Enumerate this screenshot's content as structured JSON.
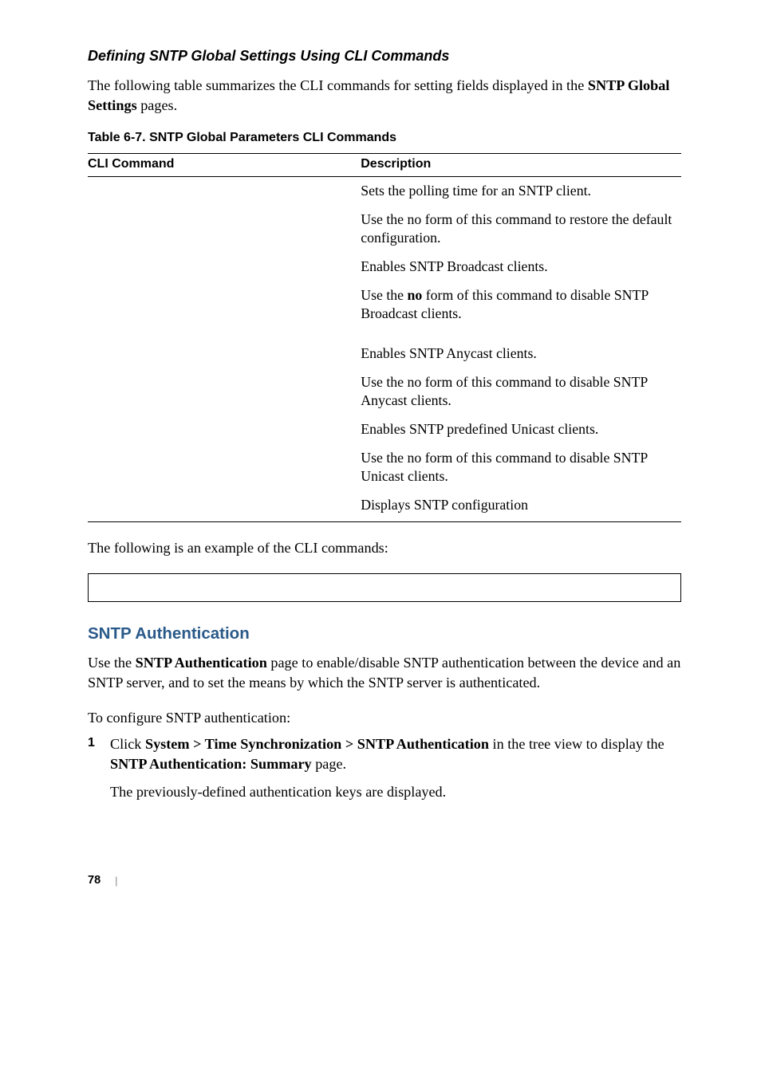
{
  "section1": {
    "heading": "Defining SNTP Global Settings Using CLI Commands",
    "intro_part1": "The following table summarizes the CLI commands for setting fields displayed in the ",
    "intro_bold": "SNTP Global Settings",
    "intro_part2": " pages."
  },
  "table": {
    "caption": "Table 6-7.    SNTP Global Parameters CLI Commands",
    "header_cmd": "CLI Command",
    "header_desc": "Description",
    "rows": [
      {
        "desc": "Sets the polling time for an SNTP client."
      },
      {
        "desc": "Use the no form of this command to restore the default configuration."
      },
      {
        "desc": "Enables SNTP Broadcast clients."
      },
      {
        "desc_pre": "Use the ",
        "desc_bold": "no",
        "desc_post": " form of this command to disable SNTP Broadcast clients."
      },
      {
        "desc": "Enables SNTP Anycast clients."
      },
      {
        "desc": "Use the no form of this command to disable SNTP Anycast clients."
      },
      {
        "desc": "Enables SNTP predefined Unicast clients."
      },
      {
        "desc": "Use the no form of this command to disable SNTP Unicast clients."
      },
      {
        "desc": "Displays SNTP configuration"
      }
    ]
  },
  "example_intro": "The following is an example of the CLI commands:",
  "section2": {
    "heading": "SNTP Authentication",
    "para1_pre": "Use the ",
    "para1_bold": "SNTP Authentication",
    "para1_post": " page to enable/disable SNTP authentication between the device and an SNTP server, and to set the means by which the SNTP server is authenticated.",
    "para2": "To configure SNTP authentication:",
    "list_num": "1",
    "list_item_pre": "Click ",
    "list_item_bold1": "System > Time Synchronization > SNTP Authentication",
    "list_item_mid": " in the tree view to display the ",
    "list_item_bold2": "SNTP Authentication: Summary",
    "list_item_post": " page.",
    "list_subtext": "The previously-defined authentication keys are displayed."
  },
  "footer": {
    "page_number": "78"
  }
}
